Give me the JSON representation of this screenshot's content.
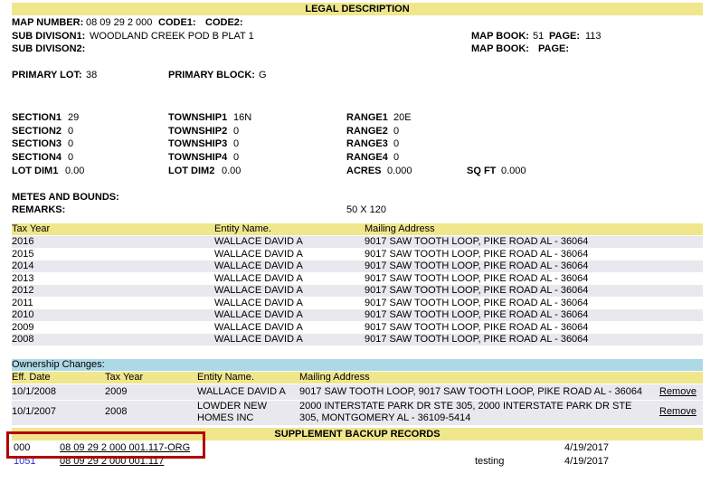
{
  "legal": {
    "header": "LEGAL DESCRIPTION",
    "map_number_label": "MAP NUMBER:",
    "map_number": "08 09 29 2 000",
    "code1_label": "CODE1:",
    "code2_label": "CODE2:",
    "sub1_label": "SUB DIVISON1:",
    "sub1": "WOODLAND CREEK POD B PLAT 1",
    "sub2_label": "SUB DIVISON2:",
    "mapbook1_label": "MAP BOOK:",
    "mapbook1": "51",
    "page1_label": "PAGE:",
    "page1": "113",
    "mapbook2_label": "MAP BOOK:",
    "page2_label": "PAGE:",
    "primary_lot_label": "PRIMARY LOT:",
    "primary_lot": "38",
    "primary_block_label": "PRIMARY BLOCK:",
    "primary_block": "G",
    "sections": [
      {
        "sec_label": "SECTION1",
        "sec": "29",
        "twp_label": "TOWNSHIP1",
        "twp": "16N",
        "rng_label": "RANGE1",
        "rng": "20E"
      },
      {
        "sec_label": "SECTION2",
        "sec": "0",
        "twp_label": "TOWNSHIP2",
        "twp": "0",
        "rng_label": "RANGE2",
        "rng": "0"
      },
      {
        "sec_label": "SECTION3",
        "sec": "0",
        "twp_label": "TOWNSHIP3",
        "twp": "0",
        "rng_label": "RANGE3",
        "rng": "0"
      },
      {
        "sec_label": "SECTION4",
        "sec": "0",
        "twp_label": "TOWNSHIP4",
        "twp": "0",
        "rng_label": "RANGE4",
        "rng": "0"
      }
    ],
    "lotdim1_label": "LOT DIM1",
    "lotdim1": "0.00",
    "lotdim2_label": "LOT DIM2",
    "lotdim2": "0.00",
    "acres_label": "ACRES",
    "acres": "0.000",
    "sqft_label": "SQ FT",
    "sqft": "0.000",
    "metes_label": "METES AND BOUNDS:",
    "remarks_label": "REMARKS:",
    "remarks": "50 X 120"
  },
  "tax_table": {
    "headers": [
      "Tax Year",
      "Entity Name.",
      "Mailing Address"
    ],
    "rows": [
      [
        "2016",
        "WALLACE DAVID A",
        "9017 SAW TOOTH LOOP, PIKE ROAD AL -  36064"
      ],
      [
        "2015",
        "WALLACE DAVID A",
        "9017 SAW TOOTH LOOP, PIKE ROAD AL -  36064"
      ],
      [
        "2014",
        "WALLACE DAVID A",
        "9017 SAW TOOTH LOOP, PIKE ROAD AL -  36064"
      ],
      [
        "2013",
        "WALLACE DAVID A",
        "9017 SAW TOOTH LOOP, PIKE ROAD AL -  36064"
      ],
      [
        "2012",
        "WALLACE DAVID A",
        "9017 SAW TOOTH LOOP, PIKE ROAD AL -  36064"
      ],
      [
        "2011",
        "WALLACE DAVID A",
        "9017 SAW TOOTH LOOP, PIKE ROAD AL -  36064"
      ],
      [
        "2010",
        "WALLACE DAVID A",
        "9017 SAW TOOTH LOOP, PIKE ROAD AL -  36064"
      ],
      [
        "2009",
        "WALLACE DAVID A",
        "9017 SAW TOOTH LOOP, PIKE ROAD AL -  36064"
      ],
      [
        "2008",
        "WALLACE DAVID A",
        "9017 SAW TOOTH LOOP, PIKE ROAD AL -  36064"
      ]
    ]
  },
  "ownership": {
    "title": "Ownership Changes:",
    "headers": [
      "Eff. Date",
      "Tax Year",
      "Entity Name.",
      "Mailing Address"
    ],
    "rows": [
      {
        "date": "10/1/2008",
        "year": "2009",
        "entity1": "WALLACE DAVID A",
        "entity2": "",
        "addr1": "9017 SAW TOOTH LOOP, 9017 SAW TOOTH LOOP, PIKE ROAD AL -  36064",
        "addr2": "",
        "action": "Remove"
      },
      {
        "date": "10/1/2007",
        "year": "2008",
        "entity1": "LOWDER NEW",
        "entity2": "HOMES INC",
        "addr1": "2000 INTERSTATE PARK DR STE 305, 2000 INTERSTATE PARK DR STE",
        "addr2": "305, MONTGOMERY AL -  36109-5414",
        "action": "Remove"
      }
    ]
  },
  "supplement": {
    "header": "SUPPLEMENT BACKUP RECORDS",
    "rows": [
      {
        "code": "000",
        "link": "08 09 29 2 000 001.117-ORG",
        "note": "",
        "date": "4/19/2017"
      },
      {
        "code": "1051",
        "link": "08 09 29 2 000 001.117",
        "note": "testing",
        "date": "4/19/2017"
      }
    ]
  }
}
